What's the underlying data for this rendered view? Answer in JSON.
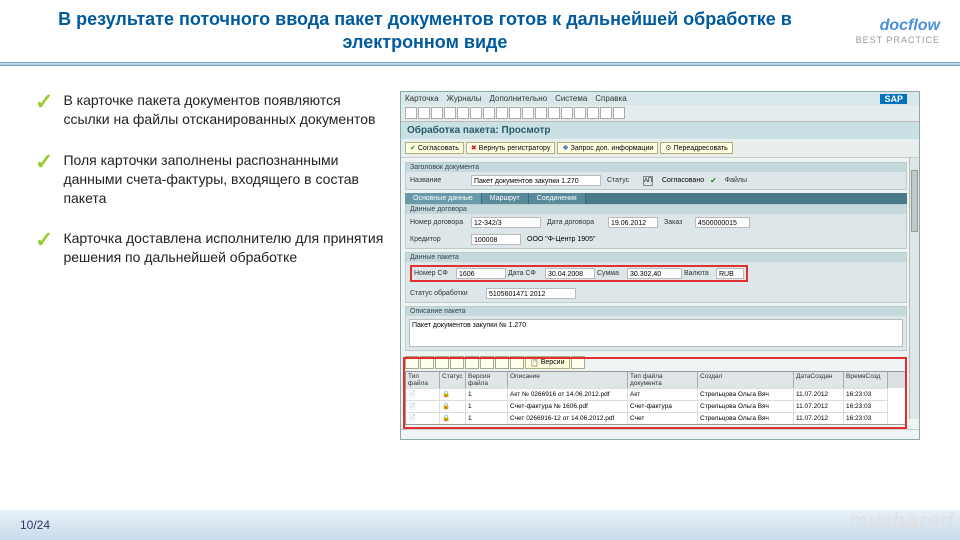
{
  "slide": {
    "title": "В результате поточного ввода пакет документов готов к дальнейшей обработке в электронном виде",
    "page": "10/24",
    "logo_top": "docflow",
    "logo_bot": "BEST PRACTICE",
    "watermark": "myshared"
  },
  "bullets": [
    "В карточке пакета документов появляются ссылки на файлы отсканированных документов",
    "Поля карточки заполнены распознанными данными счета-фактуры, входящего в состав пакета",
    "Карточка доставлена исполнителю для принятия решения по дальнейшей обработке"
  ],
  "sap": {
    "logo": "SAP",
    "menu": [
      "Карточка",
      "Журналы",
      "Дополнительно",
      "Система",
      "Справка"
    ],
    "win_title": "Обработка пакета: Просмотр",
    "actions": [
      {
        "t": "Согласовать",
        "c": "green"
      },
      {
        "t": "Вернуть регистратору",
        "c": "red"
      },
      {
        "t": "Запрос доп. информации",
        "c": "blue"
      },
      {
        "t": "Переадресовать",
        "c": "gear"
      }
    ],
    "sec1": {
      "h": "Заголовок документа",
      "name_l": "Название",
      "name_v": "Пакет документов закупки 1.270",
      "stat_l": "Статус",
      "stat_sq": "AП",
      "stat_v": "Согласовано",
      "files_l": "Файлы"
    },
    "tabs": [
      "Основные данные",
      "Маршрут",
      "Соединения"
    ],
    "sec2": {
      "h": "Данные договора",
      "num_l": "Номер договора",
      "num_v": "12-342/3",
      "date_l": "Дата договора",
      "date_v": "19.06.2012",
      "ord_l": "Заказ",
      "ord_v": "4500000015",
      "cred_l": "Кредитор",
      "cred_v": "100008",
      "cred_n": "ООО \"Ф-Центр 1905\""
    },
    "sec3": {
      "h": "Данные пакета",
      "nsf_l": "Номер СФ",
      "nsf_v": "1606",
      "dsf_l": "Дата СФ",
      "dsf_v": "30.04.2008",
      "sum_l": "Сумма",
      "sum_v": "30.302,40",
      "cur_l": "Валюта",
      "cur_v": "RUB",
      "st_l": "Статус обработки",
      "st_v": "5105601471 2012"
    },
    "sec4": {
      "h": "Описание пакета",
      "txt": "Пакет документов закупки № 1.270"
    },
    "grid": {
      "version_btn": "Версии",
      "cols": [
        "Тип файла",
        "Статус",
        "Версия файла",
        "Описание",
        "Тип файла документа",
        "Создал",
        "ДатаСоздан",
        "ВремяСозд"
      ],
      "rows": [
        [
          "📄",
          "🔒",
          "1",
          "Акт № 0266916 от 14.06.2012.pdf",
          "Акт",
          "Стрельцова Ольга Вяч",
          "11.07.2012",
          "16:23:03"
        ],
        [
          "📄",
          "🔒",
          "1",
          "Счет-фактура № 1606.pdf",
          "Счет-фактура",
          "Стрельцова Ольга Вяч",
          "11.07.2012",
          "16:23:03"
        ],
        [
          "📄",
          "🔒",
          "1",
          "Счет 0266916-12 от 14.06.2012.pdf",
          "Счет",
          "Стрельцова Ольга Вяч",
          "11.07.2012",
          "16:23:03"
        ]
      ]
    }
  }
}
